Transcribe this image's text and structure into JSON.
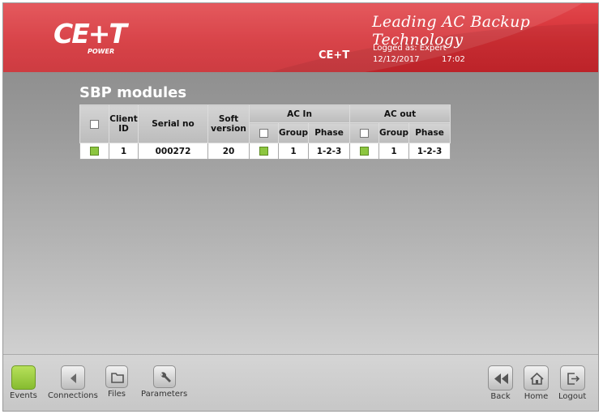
{
  "header": {
    "logo_text": "CE+T",
    "logo_sub": "POWER",
    "tagline": "Leading AC Backup Technology",
    "brand": "CE+T",
    "logged_as": "Logged as: Expert",
    "date": "12/12/2017",
    "time": "17:02"
  },
  "page": {
    "title": "SBP modules"
  },
  "table": {
    "headers": {
      "client_id": "Client ID",
      "serial_no": "Serial no",
      "soft_version": "Soft version",
      "ac_in": "AC In",
      "ac_out": "AC out",
      "group": "Group",
      "phase": "Phase"
    },
    "rows": [
      {
        "client_id": "1",
        "serial_no": "000272",
        "soft_version": "20",
        "ac_in_group": "1",
        "ac_in_phase": "1-2-3",
        "ac_out_group": "1",
        "ac_out_phase": "1-2-3"
      }
    ]
  },
  "footer": {
    "left": [
      {
        "label": "Events",
        "icon": "events-icon"
      },
      {
        "label": "Connections",
        "icon": "connections-icon"
      },
      {
        "label": "Files",
        "icon": "folder-icon"
      },
      {
        "label": "Parameters",
        "icon": "wrench-icon"
      }
    ],
    "right": [
      {
        "label": "Back",
        "icon": "rewind-icon"
      },
      {
        "label": "Home",
        "icon": "home-icon"
      },
      {
        "label": "Logout",
        "icon": "logout-icon"
      }
    ]
  },
  "colors": {
    "header_red": "#d42f35",
    "status_green": "#8cc63f",
    "events_green": "#9fd046"
  }
}
